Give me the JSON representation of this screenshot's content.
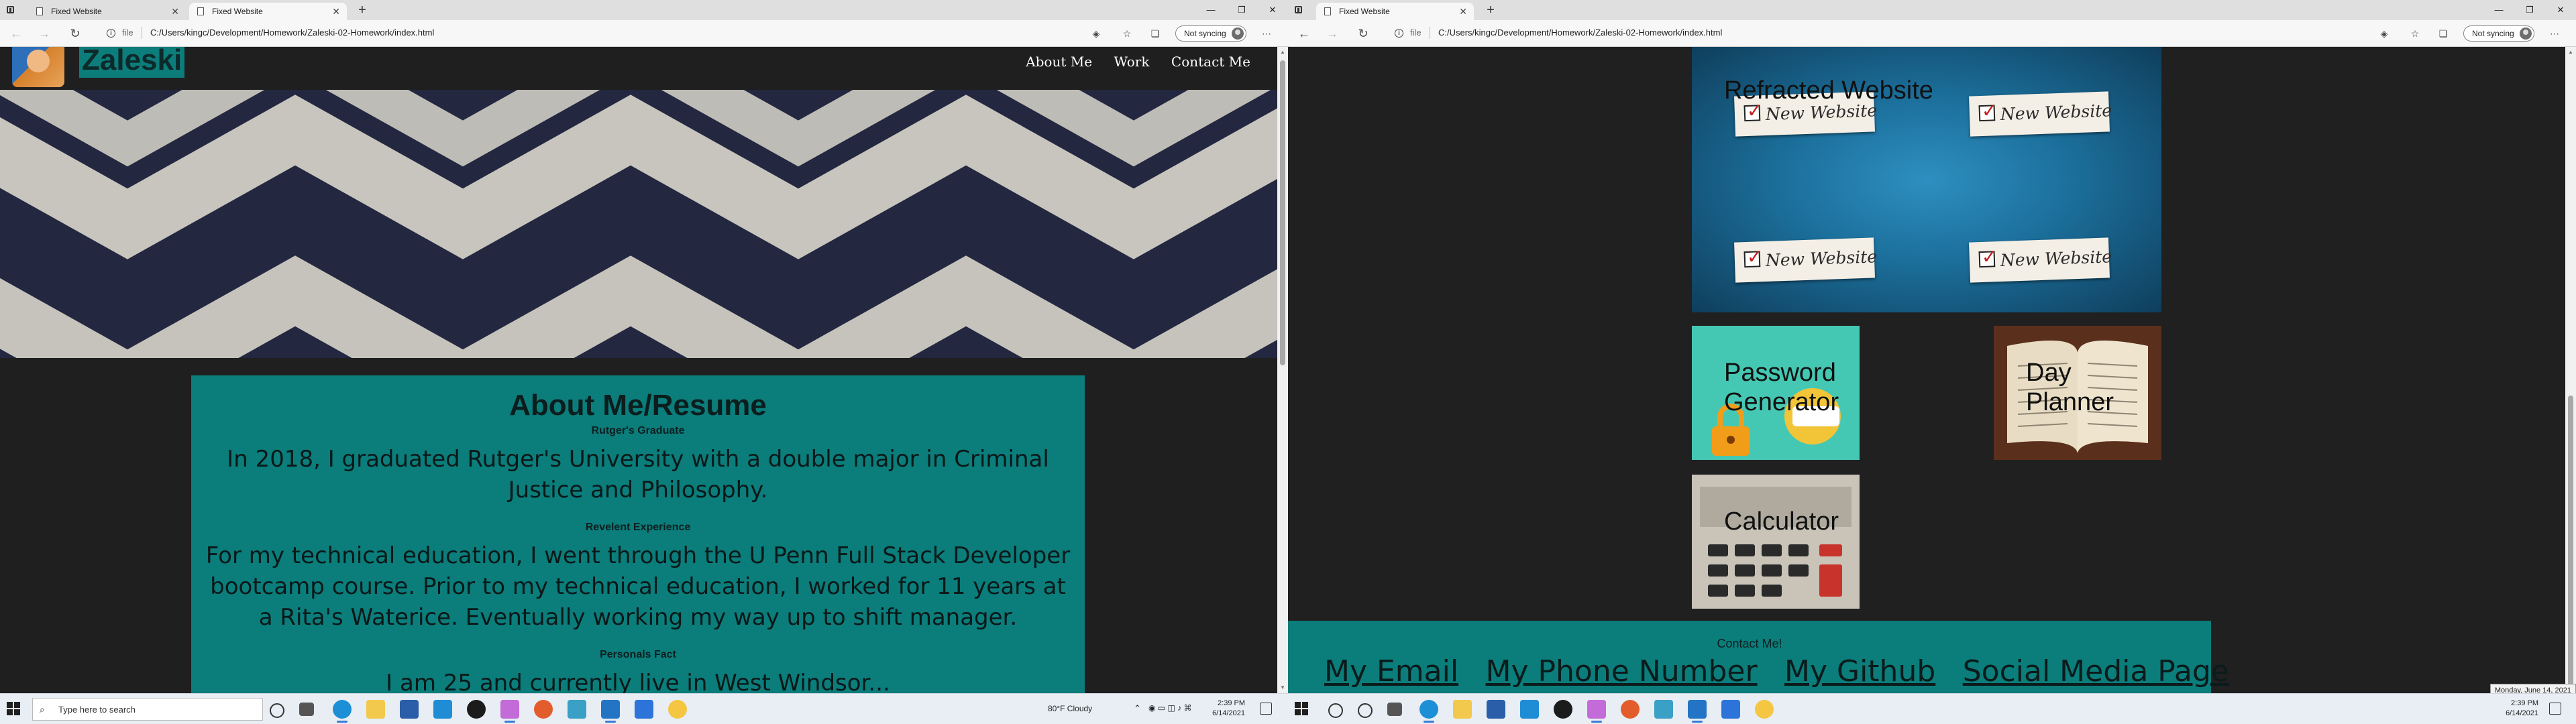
{
  "left": {
    "tabs": [
      {
        "label": "Fixed Website",
        "active": false
      },
      {
        "label": "Fixed Website",
        "active": true
      }
    ],
    "toolbar": {
      "scheme": "file",
      "url": "C:/Users/kingc/Development/Homework/Zaleski-02-Homework/index.html",
      "sync_label": "Not syncing"
    },
    "site": {
      "brand": "Zaleski",
      "nav": [
        "About Me",
        "Work",
        "Contact Me"
      ],
      "about": {
        "heading": "About Me/Resume",
        "sub1": "Rutger's Graduate",
        "para1": "In 2018, I graduated Rutger's University with a double major in Criminal Justice and Philosophy.",
        "sub2": "Revelent Experience",
        "para2": "For my technical education, I went through the U Penn Full Stack Developer bootcamp course. Prior to my technical education, I worked for 11 years at a Rita's Waterice. Eventually working my way up to shift manager.",
        "sub3": "Personals Fact",
        "para3": "I am 25 and currently live in West Windsor..."
      }
    },
    "taskbar": {
      "search_placeholder": "Type here to search",
      "weather": "80°F  Cloudy",
      "time": "2:39 PM",
      "date": "6/14/2021"
    }
  },
  "right": {
    "tabs": [
      {
        "label": "Fixed Website",
        "active": true
      }
    ],
    "toolbar": {
      "scheme": "file",
      "url": "C:/Users/kingc/Development/Homework/Zaleski-02-Homework/index.html",
      "sync_label": "Not syncing"
    },
    "work": {
      "featured_title": "Refracted Website",
      "ticket_text": "New Website",
      "cards": [
        {
          "title_line1": "Password",
          "title_line2": "Generator"
        },
        {
          "title_line1": "Day",
          "title_line2": "Planner"
        },
        {
          "title_line1": "Calculator",
          "title_line2": ""
        }
      ]
    },
    "footer": {
      "contact": "Contact Me!",
      "links": [
        "My Email",
        "My Phone Number",
        "My Github",
        "Social Media Page"
      ]
    },
    "date_tooltip": "Monday, June 14, 2021",
    "taskbar": {
      "time": "2:39 PM",
      "date": "6/14/2021"
    }
  },
  "colors": {
    "teal": "#0b7d7b",
    "page_bg": "#1f1f1f",
    "hero_navy": "#262b45",
    "chevron_light": "#d8d6cf"
  }
}
